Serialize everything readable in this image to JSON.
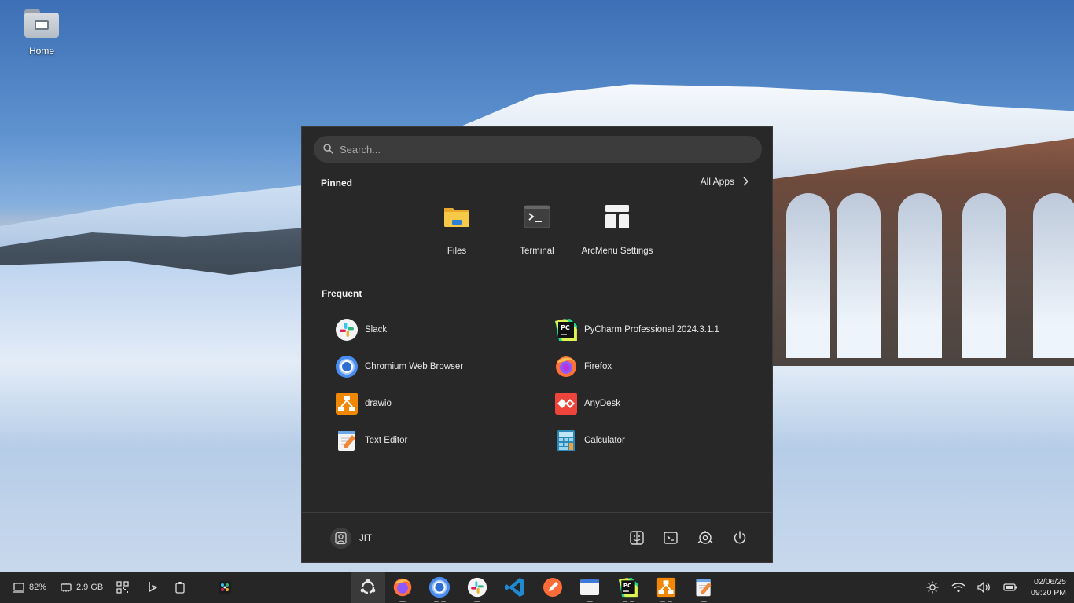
{
  "desktop": {
    "home_label": "Home"
  },
  "menu": {
    "search_placeholder": "Search...",
    "pinned_title": "Pinned",
    "all_apps_label": "All Apps",
    "pinned": [
      {
        "label": "Files",
        "icon": "folder-icon"
      },
      {
        "label": "Terminal",
        "icon": "terminal-icon"
      },
      {
        "label": "ArcMenu Settings",
        "icon": "arcmenu-settings-icon"
      }
    ],
    "frequent_title": "Frequent",
    "frequent": [
      {
        "label": "Slack",
        "icon": "slack-icon"
      },
      {
        "label": "PyCharm Professional 2024.3.1.1",
        "icon": "pycharm-icon"
      },
      {
        "label": "Chromium Web Browser",
        "icon": "chromium-icon"
      },
      {
        "label": "Firefox",
        "icon": "firefox-icon"
      },
      {
        "label": "drawio",
        "icon": "drawio-icon"
      },
      {
        "label": "AnyDesk",
        "icon": "anydesk-icon"
      },
      {
        "label": "Text Editor",
        "icon": "text-editor-icon"
      },
      {
        "label": "Calculator",
        "icon": "calculator-icon"
      }
    ],
    "user_name": "JIT"
  },
  "taskbar": {
    "cpu_percent": "82%",
    "memory": "2.9 GB",
    "date": "02/06/25",
    "time": "09:20 PM"
  }
}
